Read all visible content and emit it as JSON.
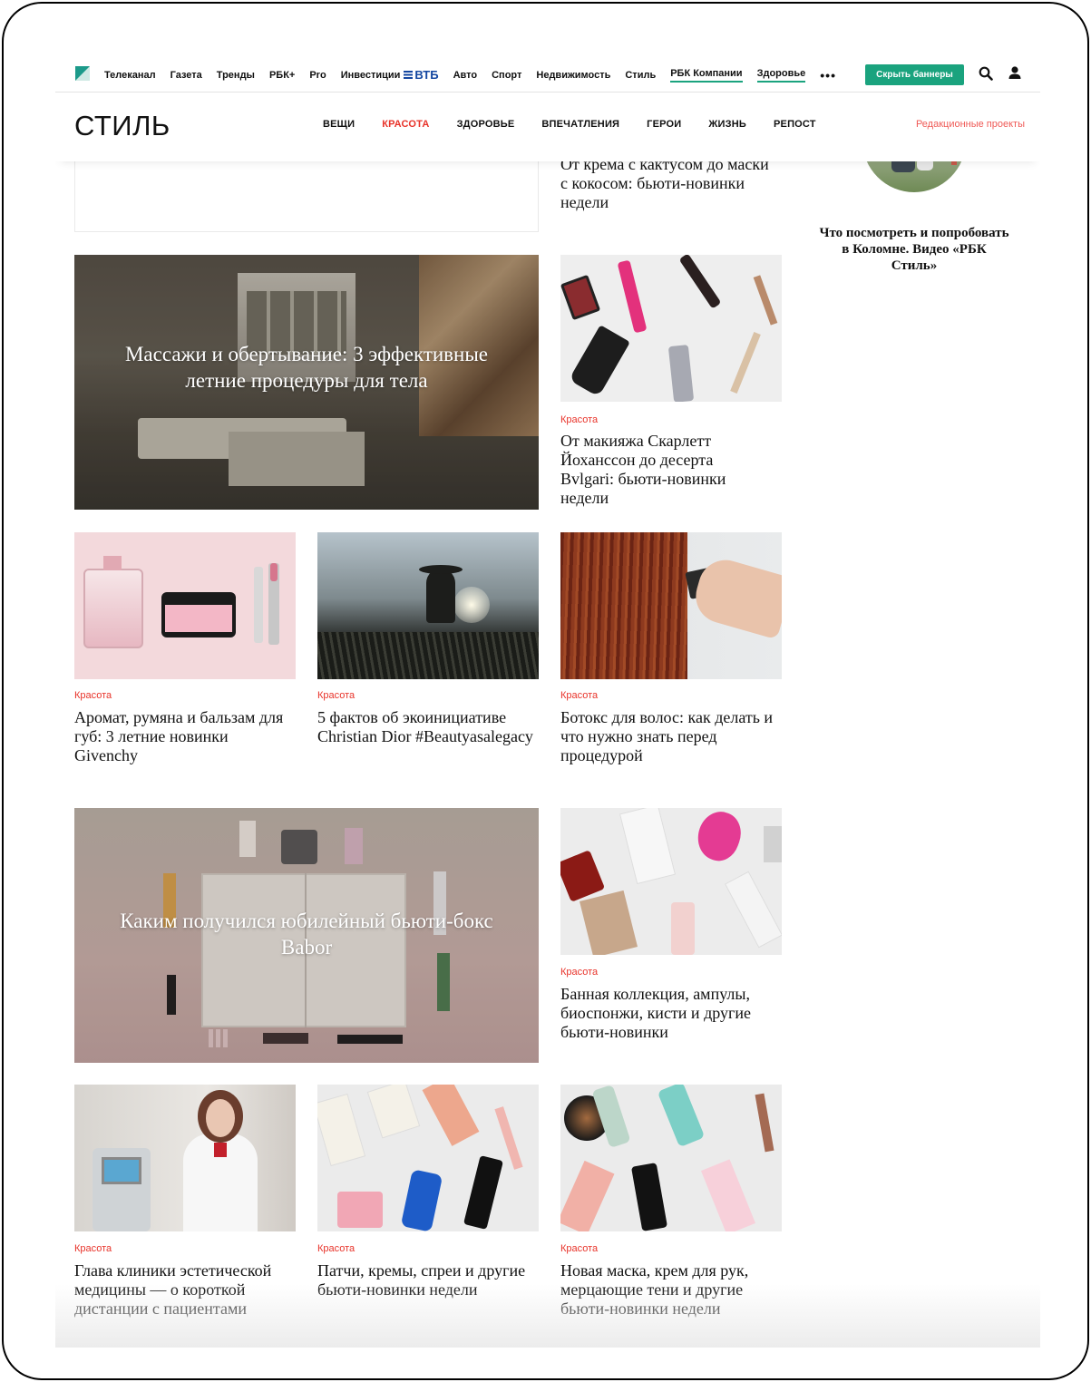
{
  "topnav": {
    "links": [
      "Телеканал",
      "Газета",
      "Тренды",
      "РБК+",
      "Pro",
      "Инвестиции"
    ],
    "vtb": "ВТБ",
    "links2": [
      "Авто",
      "Спорт",
      "Недвижимость",
      "Стиль"
    ],
    "underlined": [
      "РБК Компании",
      "Здоровье"
    ],
    "more": "•••",
    "hide_banners": "Скрыть баннеры",
    "accent": "#1aa37e"
  },
  "section": {
    "title": "СТИЛЬ",
    "nav": [
      "ВЕЩИ",
      "КРАСОТА",
      "ЗДОРОВЬЕ",
      "ВПЕЧАТЛЕНИЯ",
      "ГЕРОИ",
      "ЖИЗНЬ",
      "РЕПОСТ"
    ],
    "active": "КРАСОТА",
    "editorial": "Редакционные проекты"
  },
  "cards": {
    "top_partial": "От крема с кактусом до маски с кокосом: бьюти-новинки недели",
    "sidebar_video": "Что посмотреть и попробовать в Коломне. Видео «РБК Стиль»",
    "feature1": "Массажи и обертывание: 3 эффективные летние процедуры для тела",
    "scarlett": {
      "rubric": "Красота",
      "title": "От макияжа Скарлетт Йоханссон до десерта Bvlgari: бьюти-новинки недели"
    },
    "givenchy": {
      "rubric": "Красота",
      "title": "Аромат, румяна и бальзам для губ: 3 летние новинки Givenchy"
    },
    "dior": {
      "rubric": "Красота",
      "title": "5 фактов об экоинициативе Christian Dior #Beautyasalegacy"
    },
    "botox": {
      "rubric": "Красота",
      "title": "Ботокс для волос: как делать и что нужно знать перед процедурой"
    },
    "feature2": "Каким получился юбилейный бьюти-бокс Babor",
    "bath": {
      "rubric": "Красота",
      "title": "Банная коллекция, ампулы, биоспонжи, кисти и другие бьюти-новинки"
    },
    "clinic": {
      "rubric": "Красота",
      "title": "Глава клиники эстетической медицины — о короткой дистанции с пациентами"
    },
    "patches": {
      "rubric": "Красота",
      "title": "Патчи, кремы, спреи и другие бьюти-новинки недели"
    },
    "mask": {
      "rubric": "Красота",
      "title": "Новая маска, крем для рук, мерцающие тени и другие бьюти-новинки недели"
    }
  },
  "colors": {
    "rubric": "#e8332a",
    "editorial": "#ef5a56",
    "vtb": "#1346a0"
  }
}
